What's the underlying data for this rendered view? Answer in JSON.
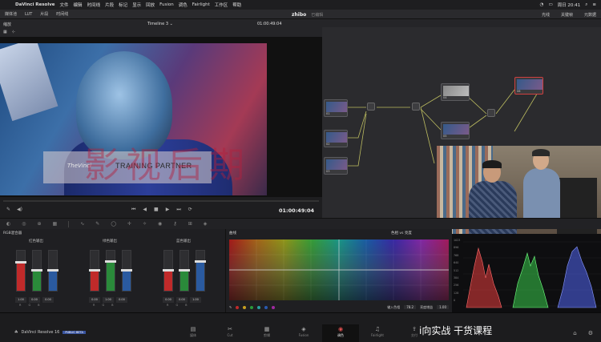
{
  "menubar": {
    "app": "DaVinci Resolve",
    "items": [
      "文件",
      "编辑",
      "时间线",
      "片段",
      "标记",
      "显示",
      "回放",
      "Fusion",
      "调色",
      "Fairlight",
      "工作区",
      "帮助"
    ],
    "clock": "周日 20:41"
  },
  "toolbar": {
    "left": [
      "媒体池",
      "LUT",
      "片段",
      "时间线"
    ],
    "project": "zhibo",
    "project_status": "已编辑",
    "right": [
      "光线",
      "关键帧",
      "元数据"
    ]
  },
  "viewer": {
    "clip_label": "缩放",
    "timeline": "Timeline 3",
    "timecode_top": "01:00:49:04",
    "timecode_bottom": "01:00:49:04",
    "lower_third_brand": "TheVinci",
    "lower_third_text": "TRAINING PARTNER"
  },
  "nodes": [
    {
      "label": "01"
    },
    {
      "label": "02"
    },
    {
      "label": "03"
    },
    {
      "label": "04"
    },
    {
      "label": "05"
    },
    {
      "label": "06"
    }
  ],
  "palette": {
    "mixer_title": "RGB混合器",
    "groups": [
      {
        "title": "红色输出",
        "vals": [
          "1.00",
          "0.00",
          "0.00"
        ],
        "letters": [
          "R",
          "G",
          "B"
        ]
      },
      {
        "title": "绿色输出",
        "vals": [
          "0.00",
          "1.00",
          "0.00"
        ],
        "letters": [
          "R",
          "G",
          "B"
        ]
      },
      {
        "title": "蓝色输出",
        "vals": [
          "0.00",
          "0.00",
          "1.00"
        ],
        "letters": [
          "R",
          "G",
          "B"
        ]
      }
    ],
    "curves_title": "曲线",
    "curves_mode": "色相 vs 亮度",
    "input_label": "输入色相",
    "input_val": "78.2",
    "lum_label": "亮度增益",
    "lum_val": "1.00",
    "bottom_left": [
      "单色",
      "保留亮度"
    ]
  },
  "scopes": {
    "scale": [
      "1023",
      "896",
      "768",
      "640",
      "512",
      "384",
      "256",
      "128",
      "0"
    ]
  },
  "watermark": "影视后期",
  "bottombar": {
    "product": "DaVinci Resolve 16",
    "beta": "PUBLIC BETA",
    "pages": [
      {
        "label": "媒体",
        "icon": "▤"
      },
      {
        "label": "Cut",
        "icon": "✂"
      },
      {
        "label": "剪辑",
        "icon": "▦"
      },
      {
        "label": "Fusion",
        "icon": "◈"
      },
      {
        "label": "调色",
        "icon": "◉"
      },
      {
        "label": "Fairlight",
        "icon": "♫"
      },
      {
        "label": "交付",
        "icon": "⇪"
      }
    ],
    "caption": "i向实战 干货课程"
  },
  "colors": {
    "accent_red": "#e05050",
    "beta_blue": "#3a55a0"
  }
}
